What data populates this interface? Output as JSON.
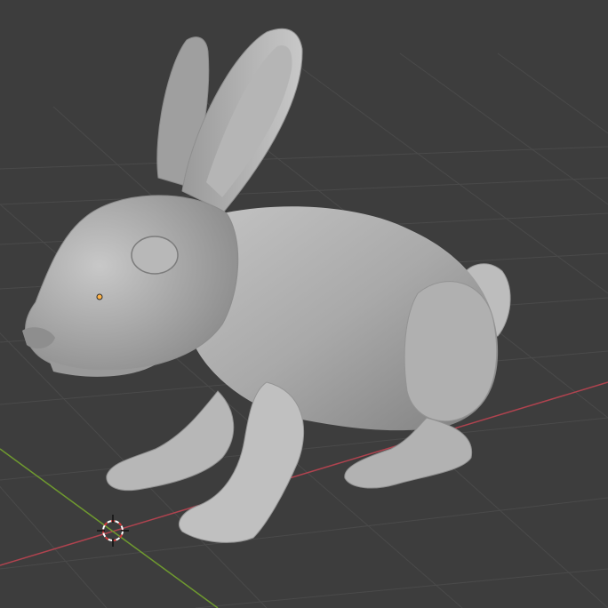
{
  "viewport": {
    "background": "#3d3d3d",
    "grid_color": "#4a4a4a",
    "x_axis_color": "#b0434f",
    "y_axis_color": "#6f9a2f",
    "mesh_color": "#a9a9a9",
    "origin_color": "#ffb347",
    "cursor_color": "#d23a3a"
  },
  "object": {
    "name": "",
    "icon": "rabbit-mesh"
  },
  "icons": {
    "cursor": "3d-cursor-icon",
    "origin": "object-origin-icon"
  }
}
